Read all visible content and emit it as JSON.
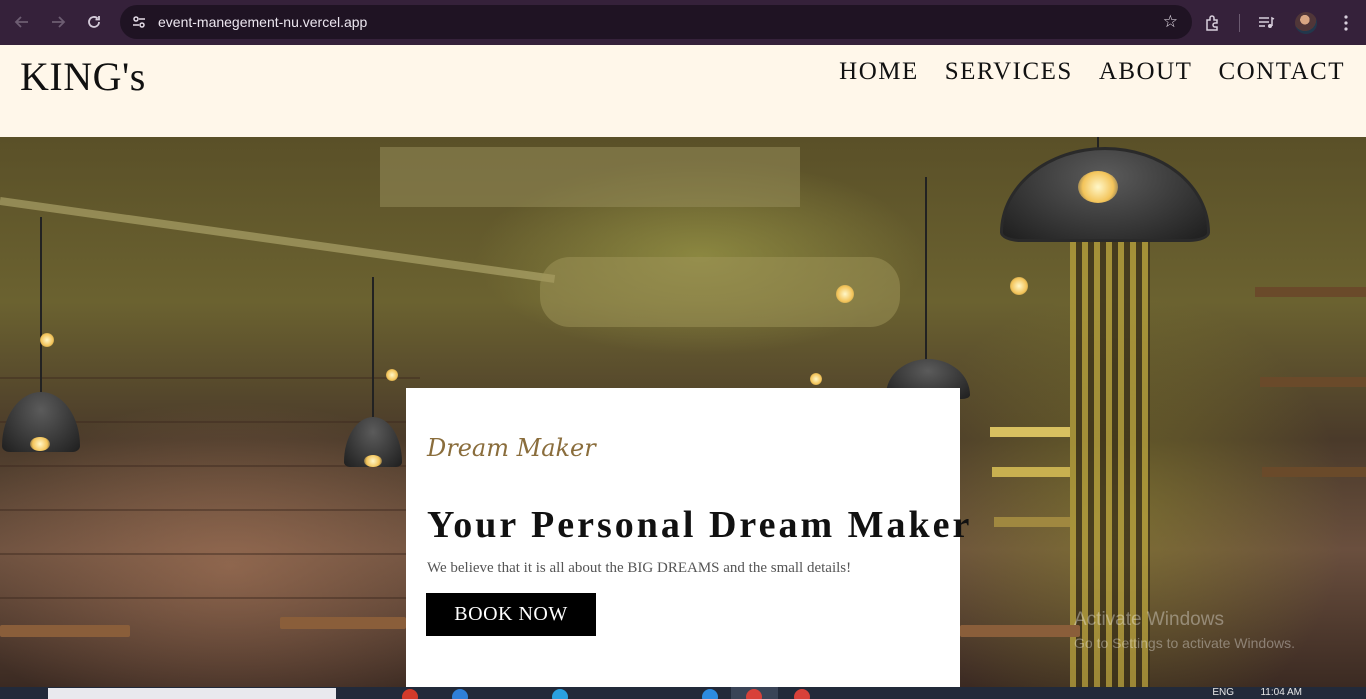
{
  "browser": {
    "url": "event-manegement-nu.vercel.app",
    "icons": [
      "back-arrow-icon",
      "forward-arrow-icon",
      "reload-icon",
      "site-info-icon",
      "bookmark-star-icon",
      "extensions-icon",
      "media-control-icon",
      "profile-avatar",
      "more-menu-icon"
    ]
  },
  "site": {
    "brand": "KING's",
    "nav": [
      "HOME",
      "SERVICES",
      "ABOUT",
      "CONTACT"
    ]
  },
  "hero": {
    "tagline": "Dream Maker",
    "headline": "Your Personal Dream Maker",
    "subtext": "We believe that it is all about the BIG DREAMS and the small details!",
    "cta": "BOOK NOW"
  },
  "watermark": {
    "line1": "Activate Windows",
    "line2": "Go to Settings to activate Windows."
  },
  "taskbar": {
    "lang": "ENG",
    "time": "11:04 AM"
  }
}
